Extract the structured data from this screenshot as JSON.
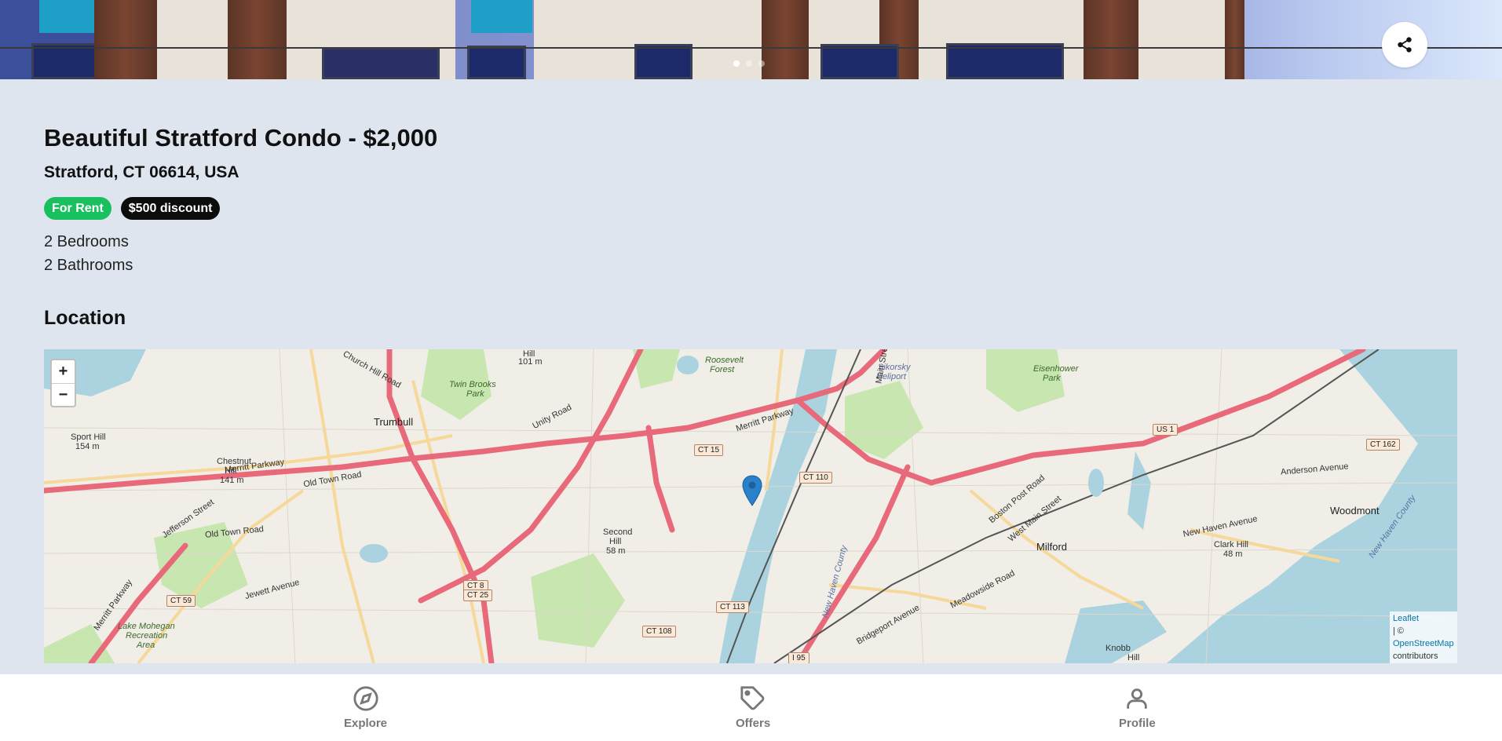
{
  "hero": {
    "dots": 3,
    "active_dot": 0,
    "share_icon": "share-icon"
  },
  "listing": {
    "title": "Beautiful Stratford Condo - $2,000",
    "address": "Stratford, CT 06614, USA",
    "badges": [
      "For Rent",
      "$500 discount"
    ],
    "bedrooms": "2 Bedrooms",
    "bathrooms": "2 Bathrooms"
  },
  "location": {
    "heading": "Location"
  },
  "map": {
    "zoom_in": "+",
    "zoom_out": "−",
    "attribution_link": "Leaflet",
    "attribution_sep": "| ©",
    "attribution_osm": "OpenStreetMap",
    "attribution_tail": "contributors",
    "labels": {
      "trumbull": "Trumbull",
      "milford": "Milford",
      "woodmont": "Woodmont",
      "sport_hill": "Sport Hill",
      "sport_hill_elev": "154 m",
      "chestnut_hill": "Chestnut",
      "chestnut_hill2": "Hill",
      "chestnut_hill_elev": "141 m",
      "twin_brooks": "Twin Brooks",
      "twin_brooks2": "Park",
      "roosevelt": "Roosevelt",
      "roosevelt2": "Forest",
      "sikorsky": "Sikorsky",
      "sikorsky2": "Heliport",
      "eisenhower": "Eisenhower",
      "eisenhower2": "Park",
      "second_hill": "Second",
      "second_hill2": "Hill",
      "second_hill_elev": "58 m",
      "clark_hill": "Clark Hill",
      "clark_hill_elev": "48 m",
      "knobb_hill": "Knobb",
      "knobb_hill2": "Hill",
      "lake_mohegan": "Lake Mohegan",
      "lake_mohegan2": "Recreation",
      "lake_mohegan3": "Area",
      "hill_101": "Hill",
      "hill_101_elev": "101 m",
      "merritt1": "Merritt Parkway",
      "merritt2": "Merritt Parkway",
      "merritt3": "Merritt Parkway",
      "church_hill": "Church Hill Road",
      "old_town": "Old Town Road",
      "old_town2": "Old Town Road",
      "unity": "Unity Road",
      "main_street": "Main Street",
      "boston_post": "Boston Post Road",
      "new_haven_ave": "New Haven Avenue",
      "anderson_ave": "Anderson Avenue",
      "meadowside": "Meadowside Road",
      "bridgeport_ave": "Bridgeport Avenue",
      "jefferson": "Jefferson Street",
      "jewett": "Jewett Avenue",
      "west_main": "West Main Street",
      "new_haven_county": "New Haven County",
      "new_haven_county2": "New Haven County"
    },
    "shields": {
      "ct15": "CT 15",
      "ct110": "CT 110",
      "ct113": "CT 113",
      "ct108": "CT 108",
      "ct59": "CT 59",
      "ct8": "CT 8",
      "ct25": "CT 25",
      "us1": "US 1",
      "ct162": "CT 162",
      "i95": "I 95"
    },
    "marker_icon": "map-pin-icon"
  },
  "nav": {
    "items": [
      {
        "label": "Explore",
        "icon": "compass-icon"
      },
      {
        "label": "Offers",
        "icon": "tag-icon"
      },
      {
        "label": "Profile",
        "icon": "user-icon"
      }
    ]
  },
  "colors": {
    "page_bg": "#dfe5ef",
    "for_rent": "#18c05f",
    "discount": "#0c0c0c",
    "nav_text": "#777777",
    "highway": "#e8697a",
    "water": "#aad3df",
    "park": "#c8e6b0"
  }
}
